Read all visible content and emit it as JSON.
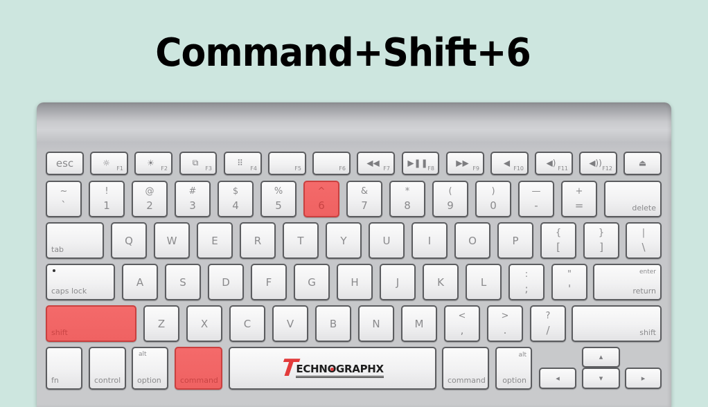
{
  "title": "Command+Shift+6",
  "highlight_color": "#f26565",
  "logo": {
    "first_letter": "T",
    "rest_before_o": "ECHN",
    "o": "O",
    "rest_after_o": "GRAPHX"
  },
  "function_row": [
    {
      "id": "esc",
      "main": "esc"
    },
    {
      "id": "f1",
      "fn": "F1",
      "icon": "brightness-down-icon",
      "glyph": "☼"
    },
    {
      "id": "f2",
      "fn": "F2",
      "icon": "brightness-up-icon",
      "glyph": "☀"
    },
    {
      "id": "f3",
      "fn": "F3",
      "icon": "mission-control-icon",
      "glyph": "⧉"
    },
    {
      "id": "f4",
      "fn": "F4",
      "icon": "launchpad-icon",
      "glyph": "⠿"
    },
    {
      "id": "f5",
      "fn": "F5"
    },
    {
      "id": "f6",
      "fn": "F6"
    },
    {
      "id": "f7",
      "fn": "F7",
      "icon": "rewind-icon",
      "glyph": "◀◀"
    },
    {
      "id": "f8",
      "fn": "F8",
      "icon": "play-pause-icon",
      "glyph": "▶❚❚"
    },
    {
      "id": "f9",
      "fn": "F9",
      "icon": "fast-forward-icon",
      "glyph": "▶▶"
    },
    {
      "id": "f10",
      "fn": "F10",
      "icon": "mute-icon",
      "glyph": "◀"
    },
    {
      "id": "f11",
      "fn": "F11",
      "icon": "volume-down-icon",
      "glyph": "◀)"
    },
    {
      "id": "f12",
      "fn": "F12",
      "icon": "volume-up-icon",
      "glyph": "◀))"
    },
    {
      "id": "eject",
      "icon": "eject-icon",
      "glyph": "⏏"
    }
  ],
  "number_row": [
    {
      "id": "backtick",
      "up": "~",
      "down": "`"
    },
    {
      "id": "1",
      "up": "!",
      "down": "1"
    },
    {
      "id": "2",
      "up": "@",
      "down": "2"
    },
    {
      "id": "3",
      "up": "#",
      "down": "3"
    },
    {
      "id": "4",
      "up": "$",
      "down": "4"
    },
    {
      "id": "5",
      "up": "%",
      "down": "5"
    },
    {
      "id": "6",
      "up": "^",
      "down": "6",
      "highlighted": true
    },
    {
      "id": "7",
      "up": "&",
      "down": "7"
    },
    {
      "id": "8",
      "up": "*",
      "down": "8"
    },
    {
      "id": "9",
      "up": "(",
      "down": "9"
    },
    {
      "id": "0",
      "up": ")",
      "down": "0"
    },
    {
      "id": "minus",
      "up": "—",
      "down": "-"
    },
    {
      "id": "equals",
      "up": "+",
      "down": "="
    },
    {
      "id": "delete",
      "br": "delete"
    }
  ],
  "qwerty_row": [
    {
      "id": "tab",
      "bl": "tab"
    },
    {
      "id": "q",
      "main": "Q"
    },
    {
      "id": "w",
      "main": "W"
    },
    {
      "id": "e",
      "main": "E"
    },
    {
      "id": "r",
      "main": "R"
    },
    {
      "id": "t",
      "main": "T"
    },
    {
      "id": "y",
      "main": "Y"
    },
    {
      "id": "u",
      "main": "U"
    },
    {
      "id": "i",
      "main": "I"
    },
    {
      "id": "o",
      "main": "O"
    },
    {
      "id": "p",
      "main": "P"
    },
    {
      "id": "lbracket",
      "up": "{",
      "down": "["
    },
    {
      "id": "rbracket",
      "up": "}",
      "down": "]"
    },
    {
      "id": "backslash",
      "up": "|",
      "down": "\\"
    }
  ],
  "home_row": [
    {
      "id": "capslock",
      "bl": "caps lock",
      "indicator": true
    },
    {
      "id": "a",
      "main": "A"
    },
    {
      "id": "s",
      "main": "S"
    },
    {
      "id": "d",
      "main": "D"
    },
    {
      "id": "f",
      "main": "F"
    },
    {
      "id": "g",
      "main": "G"
    },
    {
      "id": "h",
      "main": "H"
    },
    {
      "id": "j",
      "main": "J"
    },
    {
      "id": "k",
      "main": "K"
    },
    {
      "id": "l",
      "main": "L"
    },
    {
      "id": "semicolon",
      "up": ":",
      "down": ";"
    },
    {
      "id": "quote",
      "up": "\"",
      "down": "'"
    },
    {
      "id": "return",
      "tr": "enter",
      "br": "return"
    }
  ],
  "shift_row": [
    {
      "id": "left-shift",
      "bl": "shift",
      "highlighted": true
    },
    {
      "id": "z",
      "main": "Z"
    },
    {
      "id": "x",
      "main": "X"
    },
    {
      "id": "c",
      "main": "C"
    },
    {
      "id": "v",
      "main": "V"
    },
    {
      "id": "b",
      "main": "B"
    },
    {
      "id": "n",
      "main": "N"
    },
    {
      "id": "m",
      "main": "M"
    },
    {
      "id": "comma",
      "up": "<",
      "down": ","
    },
    {
      "id": "period",
      "up": ">",
      "down": "."
    },
    {
      "id": "slash",
      "up": "?",
      "down": "/"
    },
    {
      "id": "right-shift",
      "br": "shift"
    }
  ],
  "bottom_row": [
    {
      "id": "fn",
      "bl": "fn"
    },
    {
      "id": "control",
      "bl": "control"
    },
    {
      "id": "left-option",
      "tl": "alt",
      "bl": "option"
    },
    {
      "id": "left-command",
      "bl": "command",
      "highlighted": true
    },
    {
      "id": "space",
      "logo": true
    },
    {
      "id": "right-command",
      "bl": "command"
    },
    {
      "id": "right-option",
      "tr": "alt",
      "br": "option"
    },
    {
      "id": "arrow-left",
      "icon": "arrow-left-icon",
      "glyph": "◂"
    },
    {
      "id": "arrow-up",
      "icon": "arrow-up-icon",
      "glyph": "▴"
    },
    {
      "id": "arrow-down",
      "icon": "arrow-down-icon",
      "glyph": "▾"
    },
    {
      "id": "arrow-right",
      "icon": "arrow-right-icon",
      "glyph": "▸"
    }
  ]
}
